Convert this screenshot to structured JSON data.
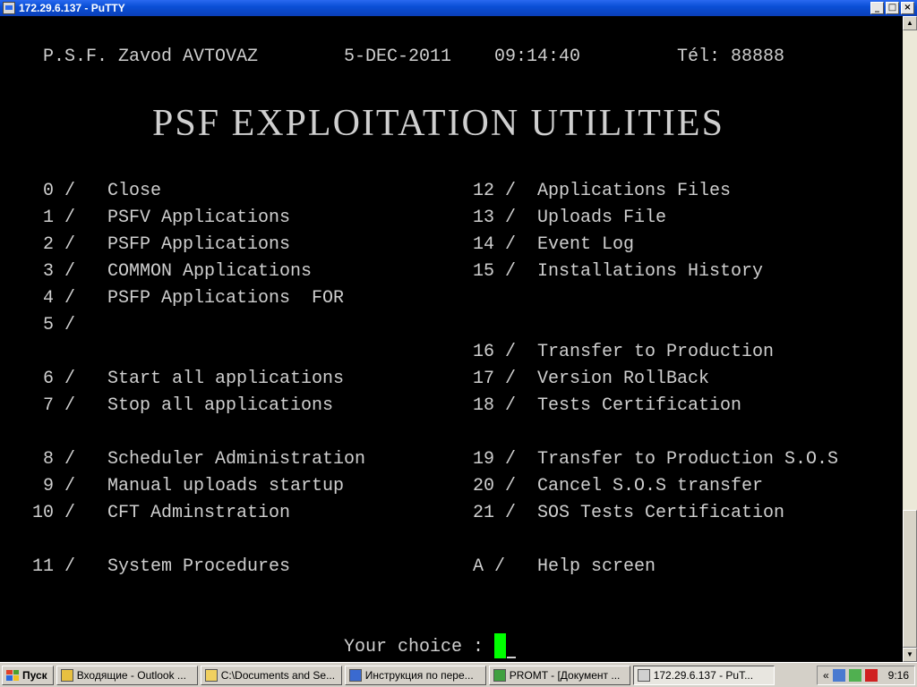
{
  "window": {
    "title": "172.29.6.137 - PuTTY",
    "buttons": {
      "minimize": "_",
      "maximize": "□",
      "close": "×"
    }
  },
  "terminal": {
    "header": {
      "company": "P.S.F. Zavod AVTOVAZ",
      "date": "5-DEC-2011",
      "time": "09:14:40",
      "phone": "Tél: 88888"
    },
    "title": "PSF EXPLOITATION UTILITIES",
    "menu_left": [
      {
        "num": " 0 /",
        "label": "Close"
      },
      {
        "num": " 1 /",
        "label": "PSFV Applications"
      },
      {
        "num": " 2 /",
        "label": "PSFP Applications"
      },
      {
        "num": " 3 /",
        "label": "COMMON Applications"
      },
      {
        "num": " 4 /",
        "label": "PSFP Applications  FOR"
      },
      {
        "num": " 5 /",
        "label": ""
      },
      {
        "num": " 6 /",
        "label": "Start all applications"
      },
      {
        "num": " 7 /",
        "label": "Stop all applications"
      },
      {
        "num": " 8 /",
        "label": "Scheduler Administration"
      },
      {
        "num": " 9 /",
        "label": "Manual uploads startup"
      },
      {
        "num": "10 /",
        "label": "CFT Adminstration"
      },
      {
        "num": "11 /",
        "label": "System Procedures"
      }
    ],
    "menu_right": [
      {
        "num": "12 /",
        "label": "Applications Files"
      },
      {
        "num": "13 /",
        "label": "Uploads File"
      },
      {
        "num": "14 /",
        "label": "Event Log"
      },
      {
        "num": "15 /",
        "label": "Installations History"
      },
      {
        "num": "16 /",
        "label": "Transfer to Production"
      },
      {
        "num": "17 /",
        "label": "Version RollBack"
      },
      {
        "num": "18 /",
        "label": "Tests Certification"
      },
      {
        "num": "19 /",
        "label": "Transfer to Production S.O.S"
      },
      {
        "num": "20 /",
        "label": "Cancel S.O.S transfer"
      },
      {
        "num": "21 /",
        "label": "SOS Tests Certification"
      },
      {
        "num": "A /",
        "label": "Help screen"
      }
    ],
    "prompt": "Your choice :",
    "cursor_color": "#00ff00"
  },
  "taskbar": {
    "start_label": "Пуск",
    "tasks": [
      {
        "label": "Входящие - Outlook ...",
        "icon": "outlook-icon",
        "color": "#e8c040"
      },
      {
        "label": "C:\\Documents and Se...",
        "icon": "folder-icon",
        "color": "#f0d060"
      },
      {
        "label": "Инструкция по пере...",
        "icon": "word-document-icon",
        "color": "#3a6ad0"
      },
      {
        "label": "PROMT - [Документ ...",
        "icon": "promt-icon",
        "color": "#40a040"
      },
      {
        "label": "172.29.6.137 - PuT...",
        "icon": "putty-icon",
        "color": "#d0d0d0"
      }
    ],
    "tray_chevron": "«",
    "clock": "9:16"
  },
  "colors": {
    "titlebar": "#0a4fd6",
    "terminal_bg": "#000000",
    "terminal_text": "#cfcfcf",
    "taskbar": "#d4d0c8"
  }
}
